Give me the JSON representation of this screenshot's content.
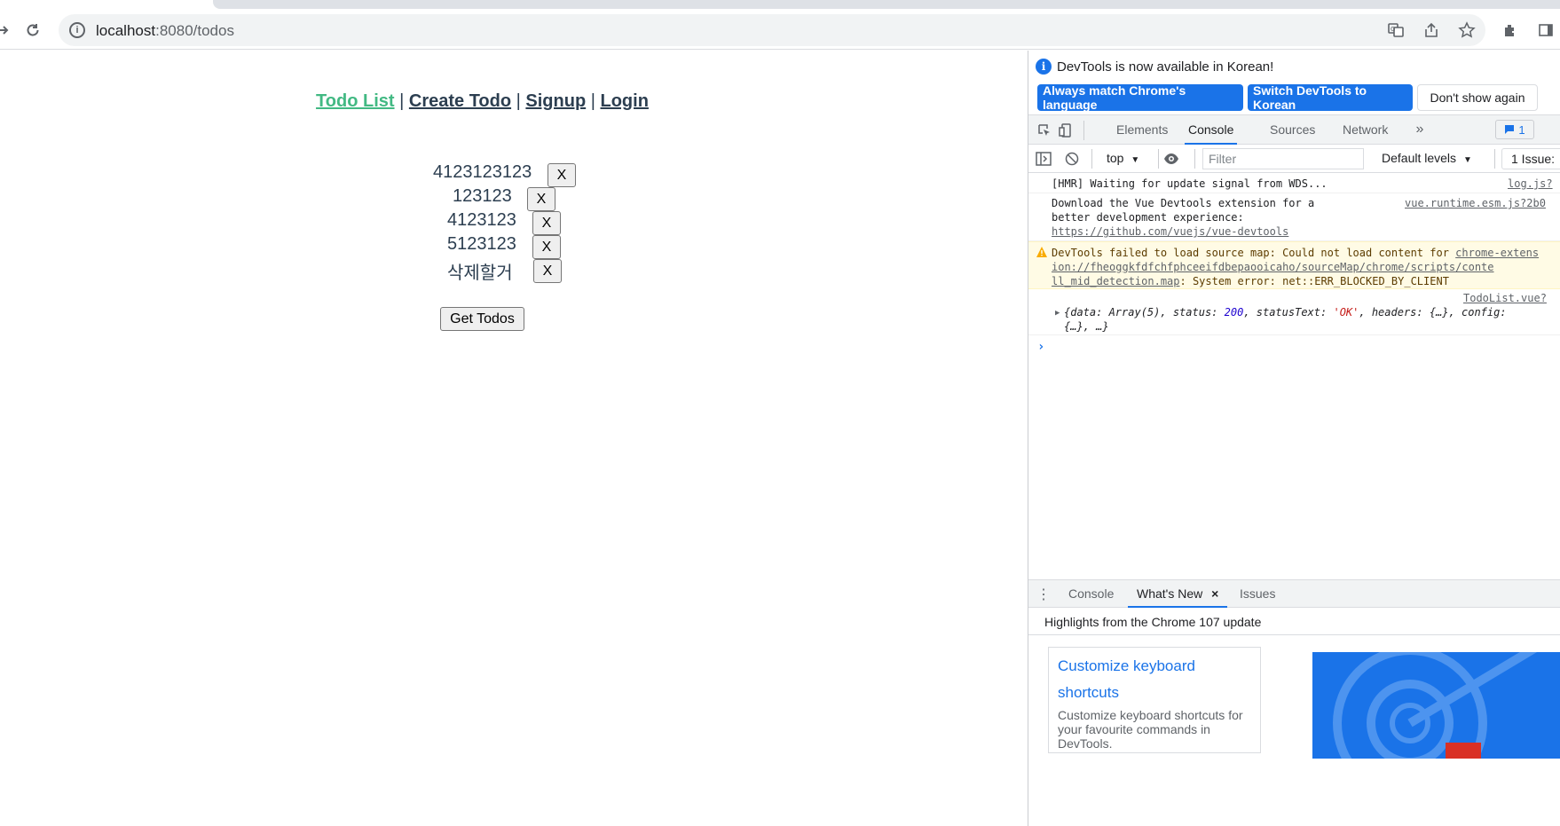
{
  "browser": {
    "url_host": "localhost",
    "url_path": ":8080/todos"
  },
  "page": {
    "nav": [
      {
        "label": "Todo List"
      },
      {
        "label": "Create Todo"
      },
      {
        "label": "Signup"
      },
      {
        "label": "Login"
      }
    ],
    "nav_separator": "|",
    "todos": [
      {
        "text": "4123123123"
      },
      {
        "text": "123123"
      },
      {
        "text": "4123123"
      },
      {
        "text": "5123123"
      },
      {
        "text": "삭제할거"
      }
    ],
    "delete_label": "X",
    "get_todos_label": "Get Todos",
    "colors": {
      "text": "#2c3e50",
      "active_link": "#42b983"
    }
  },
  "devtools": {
    "banner": {
      "message": "DevTools is now available in Korean!",
      "btn_match": "Always match Chrome's language",
      "btn_switch": "Switch DevTools to Korean",
      "btn_dismiss": "Don't show again"
    },
    "tabs": [
      "Elements",
      "Console",
      "Sources",
      "Network"
    ],
    "active_tab": "Console",
    "issues_badge": "1",
    "toolbar": {
      "context": "top",
      "filter_placeholder": "Filter",
      "levels": "Default levels",
      "issues": "1 Issue:"
    },
    "console": [
      {
        "text": "[HMR] Waiting for update signal from WDS...",
        "source": "log.js?"
      },
      {
        "text_lines": [
          "Download the Vue Devtools extension for a",
          "better development experience:"
        ],
        "link": "https://github.com/vuejs/vue-devtools",
        "source": "vue.runtime.esm.js?2b0"
      },
      {
        "level": "warning",
        "prefix": "DevTools failed to load source map: Could not load content for ",
        "link1": "chrome-extens",
        "link2": "ion://fheoggkfdfchfphceeifdbepaooicaho/sourceMap/chrome/scripts/conte",
        "link3": "ll_mid_detection.map",
        "suffix": ": System error: net::ERR_BLOCKED_BY_CLIENT"
      },
      {
        "source": "TodoList.vue?",
        "object": {
          "data": "Array(5)",
          "status": "200",
          "statusText": "'OK'",
          "headers": "{…}",
          "config": "config:",
          "tail": "{…}, …}"
        }
      }
    ],
    "drawer": {
      "tabs": [
        "Console",
        "What's New",
        "Issues"
      ],
      "active_tab": "What's New",
      "header": "Highlights from the Chrome 107 update",
      "card_title": "Customize keyboard shortcuts",
      "card_desc": "Customize keyboard shortcuts for your favourite commands in DevTools."
    }
  }
}
